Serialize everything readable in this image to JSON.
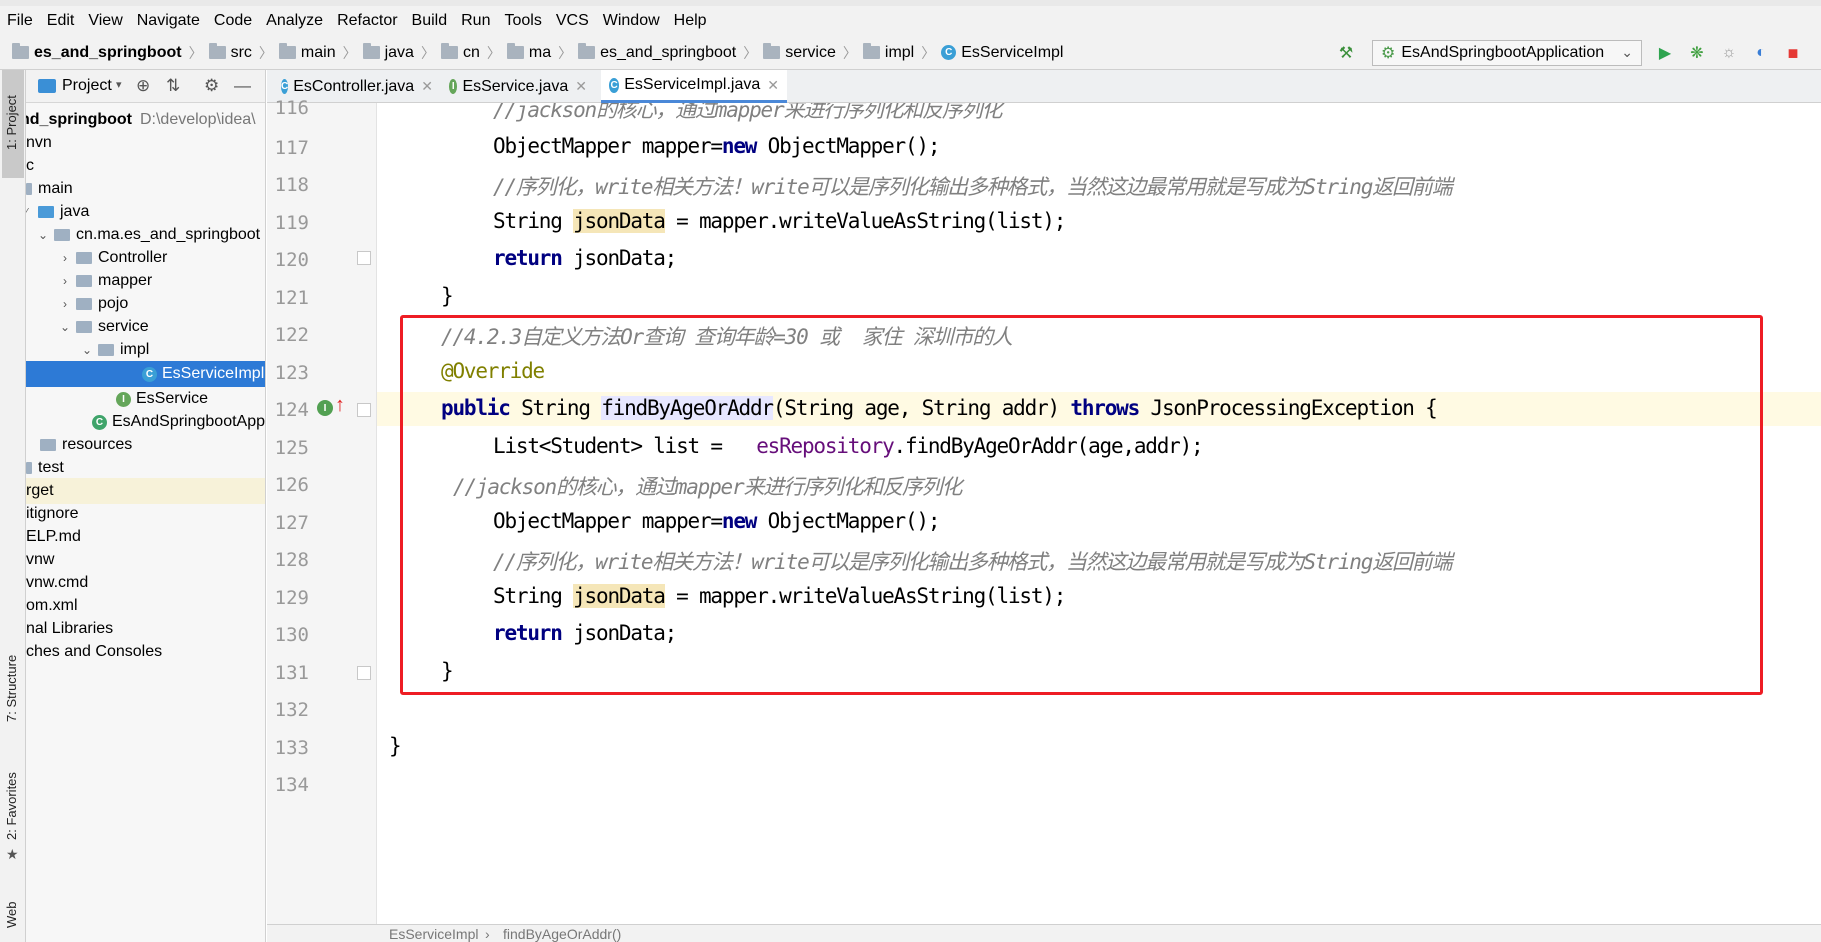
{
  "menu": [
    "File",
    "Edit",
    "View",
    "Navigate",
    "Code",
    "Analyze",
    "Refactor",
    "Build",
    "Run",
    "Tools",
    "VCS",
    "Window",
    "Help"
  ],
  "breadcrumb": [
    "es_and_springboot",
    "src",
    "main",
    "java",
    "cn",
    "ma",
    "es_and_springboot",
    "service",
    "impl",
    "EsServiceImpl"
  ],
  "run_config": "EsAndSpringbootApplication",
  "project_panel": {
    "title": "Project",
    "root_name": "nd_springboot",
    "root_path": "D:\\develop\\idea\\",
    "items": [
      "nvn",
      "c",
      "main",
      "java",
      "cn.ma.es_and_springboot",
      "Controller",
      "mapper",
      "pojo",
      "service",
      "impl",
      "EsServiceImpl",
      "EsService",
      "EsAndSpringbootApplication",
      "resources",
      "test",
      "rget",
      "itignore",
      "ELP.md",
      "vnw",
      "vnw.cmd",
      "om.xml",
      "nal Libraries",
      "ches and Consoles"
    ]
  },
  "side_tabs": {
    "project": "1: Project",
    "structure": "7: Structure",
    "favorites": "2: Favorites",
    "web": "Web"
  },
  "tabs": [
    {
      "label": "EsController.java",
      "kind": "C"
    },
    {
      "label": "EsService.java",
      "kind": "I"
    },
    {
      "label": "EsServiceImpl.java",
      "kind": "C"
    }
  ],
  "line_numbers": [
    "116",
    "117",
    "118",
    "119",
    "120",
    "121",
    "122",
    "123",
    "124",
    "125",
    "126",
    "127",
    "128",
    "129",
    "130",
    "131",
    "132",
    "133",
    "134"
  ],
  "code": {
    "l116": "//jackson的核心，通过mapper来进行序列化和反序列化",
    "l117a": "ObjectMapper mapper=",
    "l117b": "new",
    "l117c": " ObjectMapper();",
    "l118": "//序列化，write相关方法！write可以是序列化输出多种格式，当然这边最常用就是写成为String返回前端",
    "l119a": "String ",
    "l119b": "jsonData",
    "l119c": " = mapper.writeValueAsString(list);",
    "l120a": "return",
    "l120b": " jsonData;",
    "l121": "}",
    "l122": "//4.2.3自定义方法Or查询 查询年龄=30 或  家住 深圳市的人",
    "l123": "@Override",
    "l124a": "public",
    "l124b": " String ",
    "l124c": "findByAgeOrAddr",
    "l124d": "(String age, String addr) ",
    "l124e": "throws",
    "l124f": " JsonProcessingException {",
    "l125a": "List<Student> list =   ",
    "l125b": "esRepository",
    "l125c": ".findByAgeOrAddr(age,addr);",
    "l126": "//jackson的核心，通过mapper来进行序列化和反序列化",
    "l127a": "ObjectMapper mapper=",
    "l127b": "new",
    "l127c": " ObjectMapper();",
    "l128": "//序列化，write相关方法！write可以是序列化输出多种格式，当然这边最常用就是写成为String返回前端",
    "l129a": "String ",
    "l129b": "jsonData",
    "l129c": " = mapper.writeValueAsString(list);",
    "l130a": "return",
    "l130b": " jsonData;",
    "l131": "}",
    "l133": "}"
  },
  "status_breadcrumb": [
    "EsServiceImpl",
    "findByAgeOrAddr()"
  ]
}
